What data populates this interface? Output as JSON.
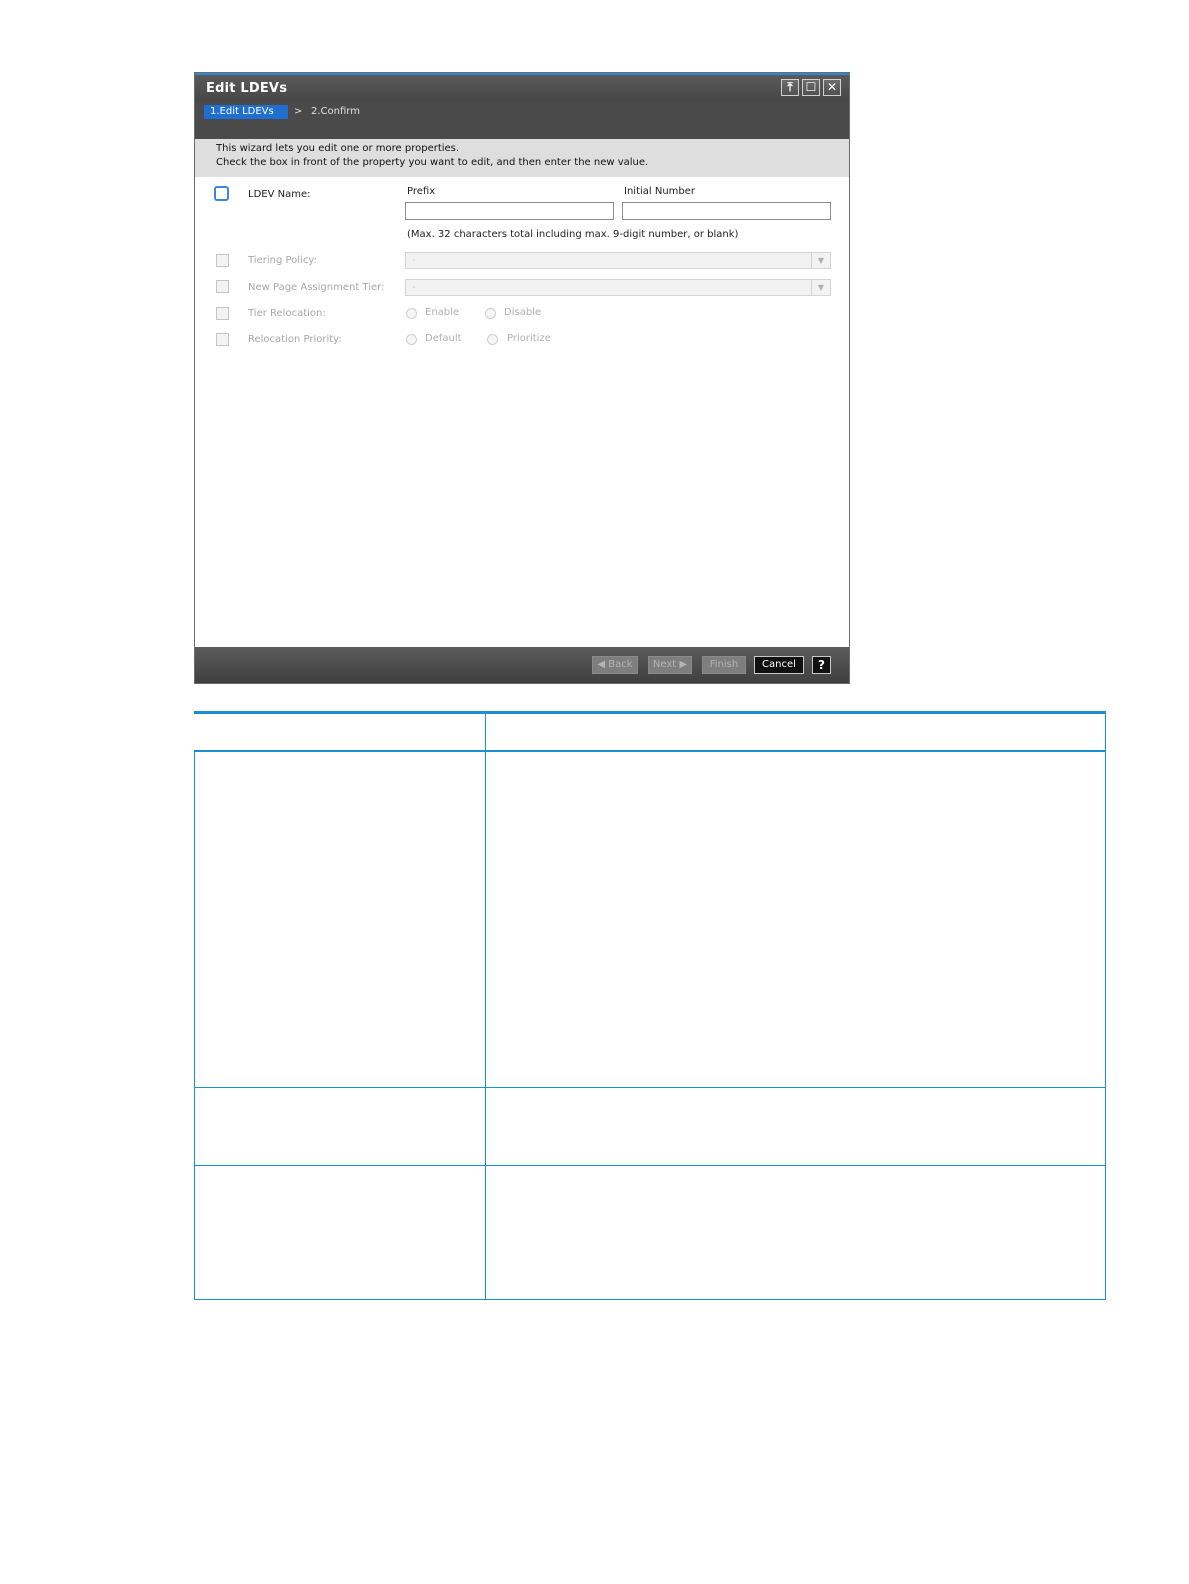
{
  "window": {
    "title": "Edit LDEVs",
    "buttons": {
      "pin": "⤒",
      "maximize": "☐",
      "close": "✕"
    }
  },
  "steps": {
    "current": "1.Edit LDEVs",
    "separator": ">",
    "next": "2.Confirm"
  },
  "instructions": {
    "line1": "This wizard lets you edit one or more properties.",
    "line2": "Check the  box in front of the property you want to edit, and then enter the new value."
  },
  "form": {
    "ldev_name": {
      "label": "LDEV Name:",
      "prefix_label": "Prefix",
      "initial_number_label": "Initial Number",
      "prefix_value": "",
      "initial_number_value": "",
      "hint": "(Max. 32 characters total including max. 9-digit number, or blank)"
    },
    "tiering_policy": {
      "label": "Tiering Policy:",
      "value": "-"
    },
    "new_page_assignment_tier": {
      "label": "New Page Assignment Tier:",
      "value": "-"
    },
    "tier_relocation": {
      "label": "Tier Relocation:",
      "options": [
        "Enable",
        "Disable"
      ]
    },
    "relocation_priority": {
      "label": "Relocation Priority:",
      "options": [
        "Default",
        "Prioritize"
      ]
    }
  },
  "footer": {
    "back": "Back",
    "next": "Next",
    "finish": "Finish",
    "cancel": "Cancel",
    "help": "?"
  },
  "colors": {
    "accent": "#1f6fd1",
    "table_rule": "#1b8fd2",
    "titlebar": "#4a4a4a"
  }
}
